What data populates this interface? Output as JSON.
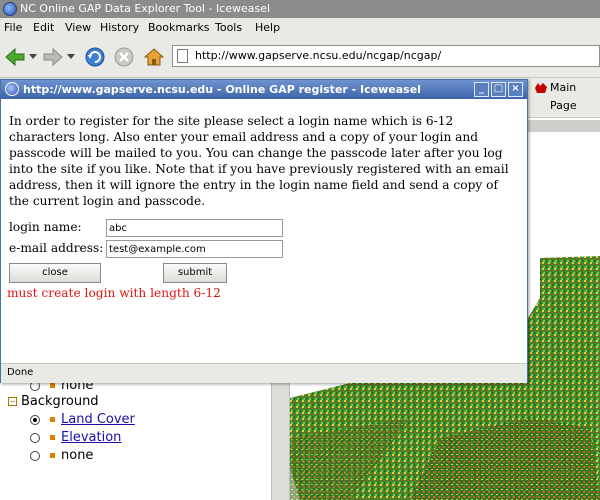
{
  "main_window": {
    "title": "NC Online GAP Data Explorer Tool - Iceweasel",
    "menu": [
      "File",
      "Edit",
      "View",
      "History",
      "Bookmarks",
      "Tools",
      "Help"
    ],
    "url": "http://www.gapserve.ncsu.edu/ncgap/ncgap/",
    "tab_label": "Main Page"
  },
  "background_page": {
    "layer_none_top": "none",
    "background_group": "Background",
    "background_options": [
      {
        "label": "Land Cover",
        "selected": true
      },
      {
        "label": "Elevation",
        "selected": false
      },
      {
        "label": "none",
        "selected": false
      }
    ]
  },
  "popup": {
    "title": "http://www.gapserve.ncsu.edu - Online GAP register - Iceweasel",
    "intro_text": "In order to register for the site please select a login name which is 6-12 characters long. Also enter your email address and a copy of your login and passcode will be mailed to you. You can change the passcode later after you log into the site if you like. Note that if you have previously registered with an email address, then it will ignore the entry in the login name field and send a copy of the current login and passcode.",
    "login_label": "login name:",
    "login_value": "abc",
    "email_label": "e-mail address:",
    "email_value": "test@example.com",
    "close_label": "close",
    "submit_label": "submit",
    "error_text": "must create login with length 6-12",
    "status": "Done"
  },
  "colors": {
    "popup_title_bar": "#4a70b0",
    "error_text": "#e31212",
    "link": "#1a0dab"
  }
}
